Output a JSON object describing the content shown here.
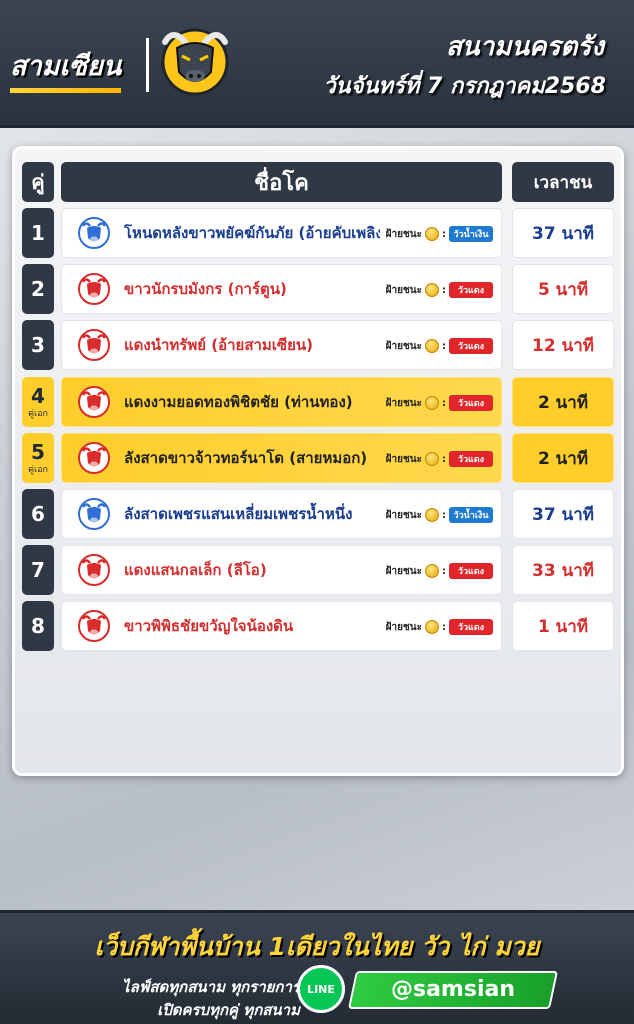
{
  "header": {
    "brand": "สามเซียน",
    "venue": "สนามนครตรัง",
    "date": "วันจันทร์ที่ 7 กรกฎาคม2568"
  },
  "table": {
    "col_no": "คู่",
    "col_name": "ชื่อโค",
    "col_time": "เวลาชน",
    "win_label": "ฝ้ายชนะ",
    "rows": [
      {
        "no": "1",
        "sub": "",
        "name": "โหนดหลังขาวพยัคฆ์กันภัย (อ้ายคับเพลิง)",
        "tag": "วัวน้ำเงิน",
        "side": "blue",
        "time": "37 นาที",
        "highlight": false
      },
      {
        "no": "2",
        "sub": "",
        "name": "ขาวนักรบมังกร (การ์ตูน)",
        "tag": "วัวแดง",
        "side": "red",
        "time": "5 นาที",
        "highlight": false
      },
      {
        "no": "3",
        "sub": "",
        "name": "แดงนำทรัพย์ (อ้ายสามเซียน)",
        "tag": "วัวแดง",
        "side": "red",
        "time": "12 นาที",
        "highlight": false
      },
      {
        "no": "4",
        "sub": "คู่เอก",
        "name": "แดงงามยอดทองพิชิตชัย (ท่านทอง)",
        "tag": "วัวแดง",
        "side": "red",
        "time": "2 นาที",
        "highlight": true
      },
      {
        "no": "5",
        "sub": "คู่เอก",
        "name": "ลังสาดขาวจ้าวทอร์นาโด (สายหมอก)",
        "tag": "วัวแดง",
        "side": "red",
        "time": "2 นาที",
        "highlight": true
      },
      {
        "no": "6",
        "sub": "",
        "name": "ลังสาดเพชรแสนเหลี่ยมเพชรน้ำหนึ่ง",
        "tag": "วัวน้ำเงิน",
        "side": "blue",
        "time": "37 นาที",
        "highlight": false
      },
      {
        "no": "7",
        "sub": "",
        "name": "แดงแสนกลเล็ก (ลีโอ)",
        "tag": "วัวแดง",
        "side": "red",
        "time": "33 นาที",
        "highlight": false
      },
      {
        "no": "8",
        "sub": "",
        "name": "ขาวพิพิธชัยขวัญใจน้องดิน",
        "tag": "วัวแดง",
        "side": "red",
        "time": "1 นาที",
        "highlight": false
      }
    ]
  },
  "footer": {
    "slogan": "เว็บกีฬาพื้นบ้าน 1เดียวในไทย  วัว  ไก่  มวย",
    "line1": "ไลฟ์สดทุกสนาม ทุกรายการ",
    "line2": "เปิดครบทุกคู่ ทุกสนาม",
    "line_label": "LINE",
    "handle": "@samsian"
  },
  "colors": {
    "blue_side": "#1a3d8f",
    "red_side": "#d32f2f",
    "highlight": "#ffce2b",
    "dark": "#2f3844"
  }
}
